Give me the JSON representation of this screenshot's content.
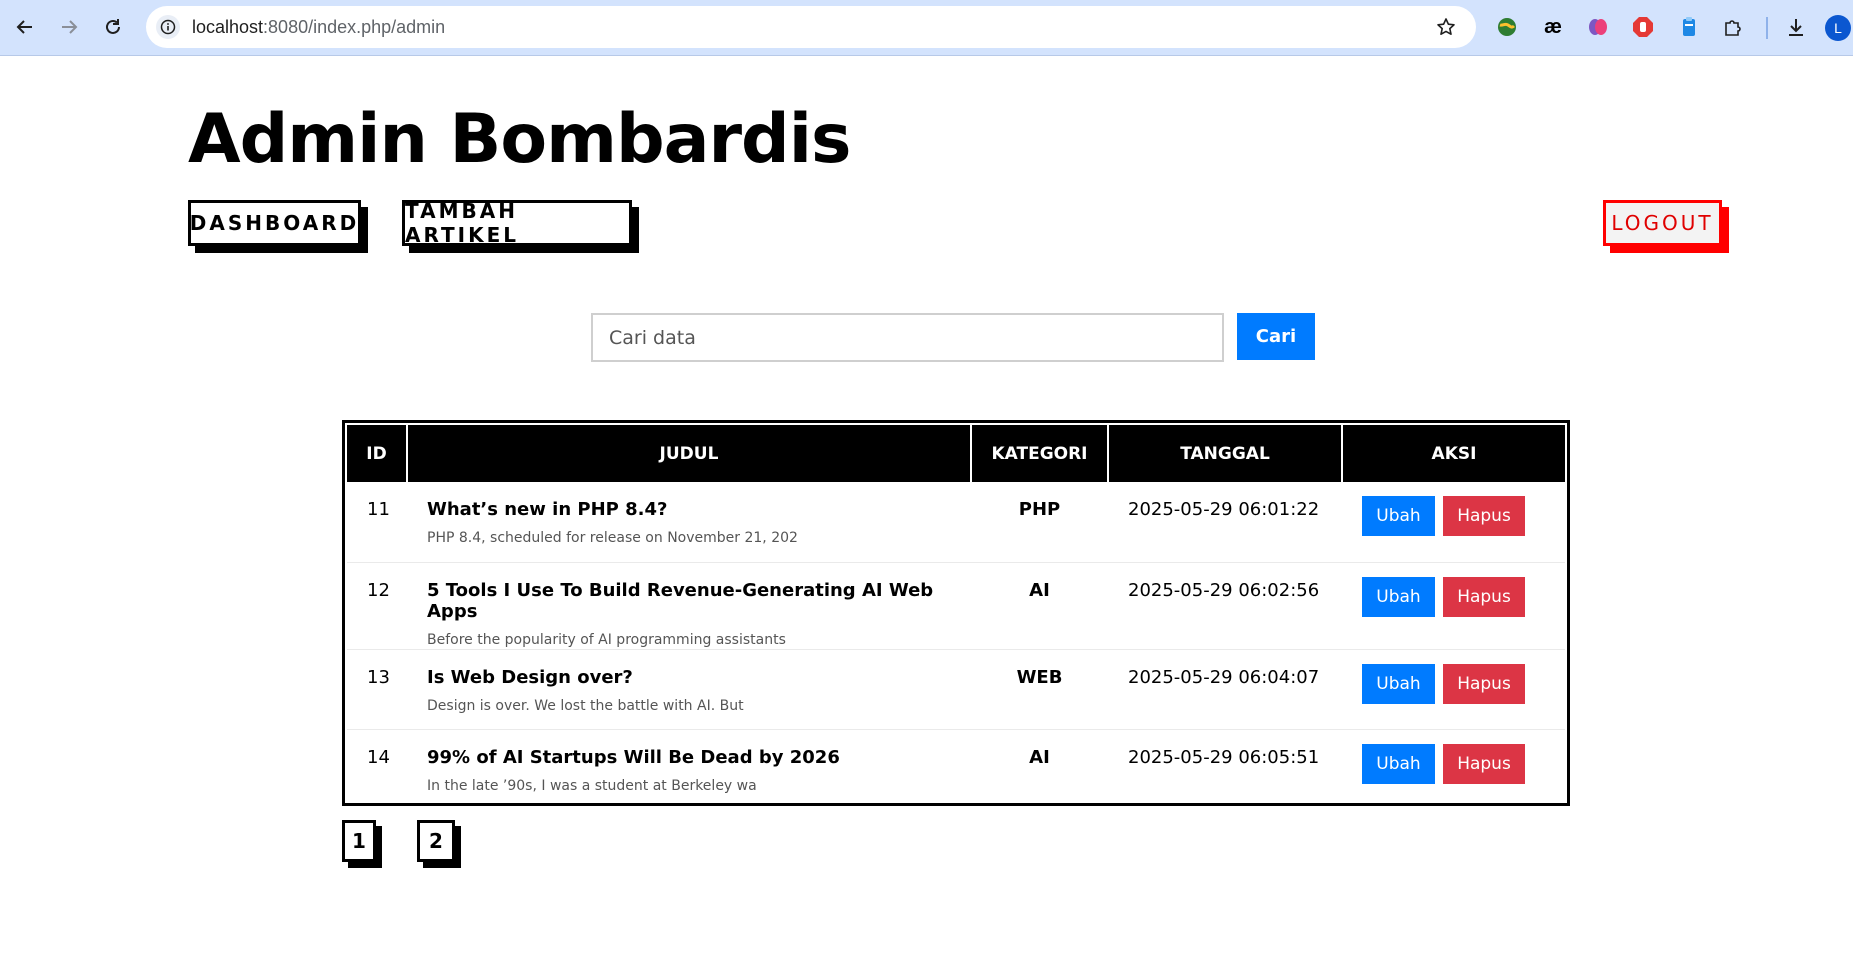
{
  "browser": {
    "url_host": "localhost",
    "url_rest": ":8080/index.php/admin",
    "profile_initial": "L",
    "extensions": [
      "globe-extension-icon",
      "ae-extension-icon",
      "brain-extension-icon",
      "stop-extension-icon",
      "clipboard-extension-icon",
      "puzzle-extension-icon"
    ],
    "ae_label": "æ"
  },
  "header": {
    "title": "Admin Bombardis",
    "nav": {
      "dashboard": "DASHBOARD",
      "tambah": "TAMBAH ARTIKEL",
      "logout": "LOGOUT"
    }
  },
  "search": {
    "placeholder": "Cari data",
    "button": "Cari"
  },
  "table": {
    "headers": [
      "ID",
      "JUDUL",
      "KATEGORI",
      "TANGGAL",
      "AKSI"
    ],
    "rows": [
      {
        "id": "11",
        "title": "What’s new in PHP 8.4?",
        "snippet": "PHP 8.4, scheduled for release on November 21, 202",
        "kategori": "PHP",
        "tanggal": "2025-05-29 06:01:22"
      },
      {
        "id": "12",
        "title": "5 Tools I Use To Build Revenue-Generating AI Web Apps",
        "snippet": "Before the popularity of AI programming assistants",
        "kategori": "AI",
        "tanggal": "2025-05-29 06:02:56"
      },
      {
        "id": "13",
        "title": "Is Web Design over?",
        "snippet": "Design is over. We lost the battle with AI. But",
        "kategori": "WEB",
        "tanggal": "2025-05-29 06:04:07"
      },
      {
        "id": "14",
        "title": "99% of AI Startups Will Be Dead by 2026",
        "snippet": "In the late ’90s, I was a student at Berkeley wa",
        "kategori": "AI",
        "tanggal": "2025-05-29 06:05:51"
      }
    ],
    "action_edit": "Ubah",
    "action_delete": "Hapus"
  },
  "pagination": [
    "1",
    "2"
  ]
}
